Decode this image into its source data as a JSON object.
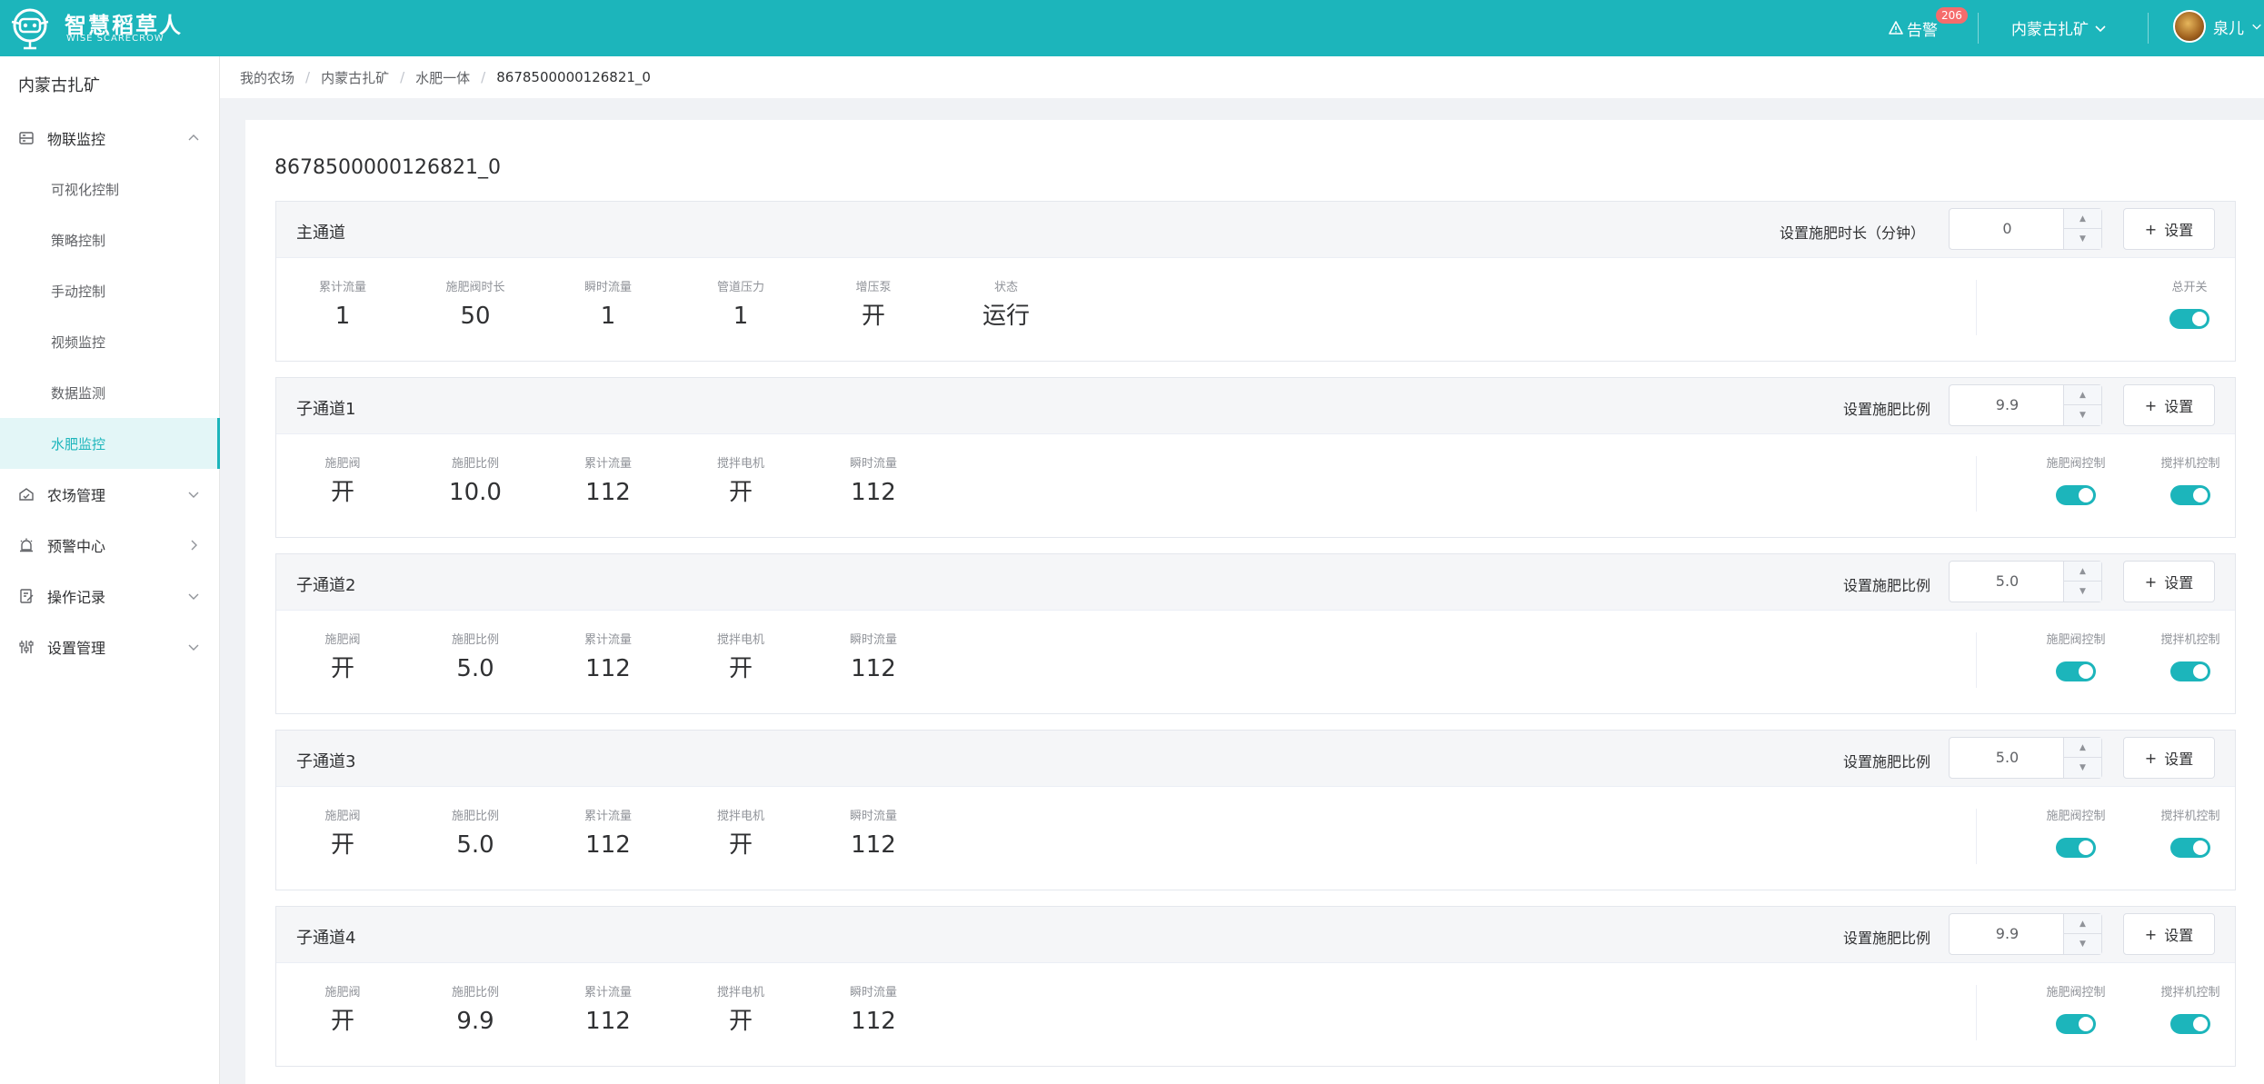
{
  "brand": {
    "title": "智慧稻草人",
    "subtitle": "WISE SCARECROW"
  },
  "header": {
    "alarm_label": "告警",
    "alarm_count": "206",
    "farm_selector": "内蒙古扎矿",
    "user_name": "泉儿",
    "accent_color": "#1cb5bb"
  },
  "sidebar": {
    "title": "内蒙古扎矿",
    "menu": [
      {
        "label": "物联监控",
        "icon": "iot-icon",
        "expanded": true
      },
      {
        "label": "可视化控制"
      },
      {
        "label": "策略控制"
      },
      {
        "label": "手动控制"
      },
      {
        "label": "视频监控"
      },
      {
        "label": "数据监测"
      },
      {
        "label": "水肥监控",
        "active": true
      },
      {
        "label": "农场管理",
        "icon": "farm-icon"
      },
      {
        "label": "预警中心",
        "icon": "alarm-center-icon"
      },
      {
        "label": "操作记录",
        "icon": "record-icon"
      },
      {
        "label": "设置管理",
        "icon": "settings-icon"
      }
    ]
  },
  "breadcrumb": [
    "我的农场",
    "内蒙古扎矿",
    "水肥一体",
    "8678500000126821_0"
  ],
  "device_title": "8678500000126821_0",
  "main_channel": {
    "name": "主通道",
    "set_label": "设置施肥时长（分钟）",
    "set_value": "0",
    "set_button": "设置",
    "stats": [
      {
        "label": "累计流量",
        "value": "1"
      },
      {
        "label": "施肥阀时长",
        "value": "50"
      },
      {
        "label": "瞬时流量",
        "value": "1"
      },
      {
        "label": "管道压力",
        "value": "1"
      },
      {
        "label": "增压泵",
        "value": "开"
      },
      {
        "label": "状态",
        "value": "运行"
      }
    ],
    "switch_label": "总开关",
    "switch_on": true
  },
  "sub_channels": [
    {
      "name": "子通道1",
      "set_label": "设置施肥比例",
      "set_value": "9.9",
      "set_button": "设置",
      "stats": [
        {
          "label": "施肥阀",
          "value": "开"
        },
        {
          "label": "施肥比例",
          "value": "10.0"
        },
        {
          "label": "累计流量",
          "value": "112"
        },
        {
          "label": "搅拌电机",
          "value": "开"
        },
        {
          "label": "瞬时流量",
          "value": "112"
        }
      ],
      "switch1_label": "施肥阀控制",
      "switch2_label": "搅拌机控制"
    },
    {
      "name": "子通道2",
      "set_label": "设置施肥比例",
      "set_value": "5.0",
      "set_button": "设置",
      "stats": [
        {
          "label": "施肥阀",
          "value": "开"
        },
        {
          "label": "施肥比例",
          "value": "5.0"
        },
        {
          "label": "累计流量",
          "value": "112"
        },
        {
          "label": "搅拌电机",
          "value": "开"
        },
        {
          "label": "瞬时流量",
          "value": "112"
        }
      ],
      "switch1_label": "施肥阀控制",
      "switch2_label": "搅拌机控制"
    },
    {
      "name": "子通道3",
      "set_label": "设置施肥比例",
      "set_value": "5.0",
      "set_button": "设置",
      "stats": [
        {
          "label": "施肥阀",
          "value": "开"
        },
        {
          "label": "施肥比例",
          "value": "5.0"
        },
        {
          "label": "累计流量",
          "value": "112"
        },
        {
          "label": "搅拌电机",
          "value": "开"
        },
        {
          "label": "瞬时流量",
          "value": "112"
        }
      ],
      "switch1_label": "施肥阀控制",
      "switch2_label": "搅拌机控制"
    },
    {
      "name": "子通道4",
      "set_label": "设置施肥比例",
      "set_value": "9.9",
      "set_button": "设置",
      "stats": [
        {
          "label": "施肥阀",
          "value": "开"
        },
        {
          "label": "施肥比例",
          "value": "9.9"
        },
        {
          "label": "累计流量",
          "value": "112"
        },
        {
          "label": "搅拌电机",
          "value": "开"
        },
        {
          "label": "瞬时流量",
          "value": "112"
        }
      ],
      "switch1_label": "施肥阀控制",
      "switch2_label": "搅拌机控制"
    }
  ]
}
